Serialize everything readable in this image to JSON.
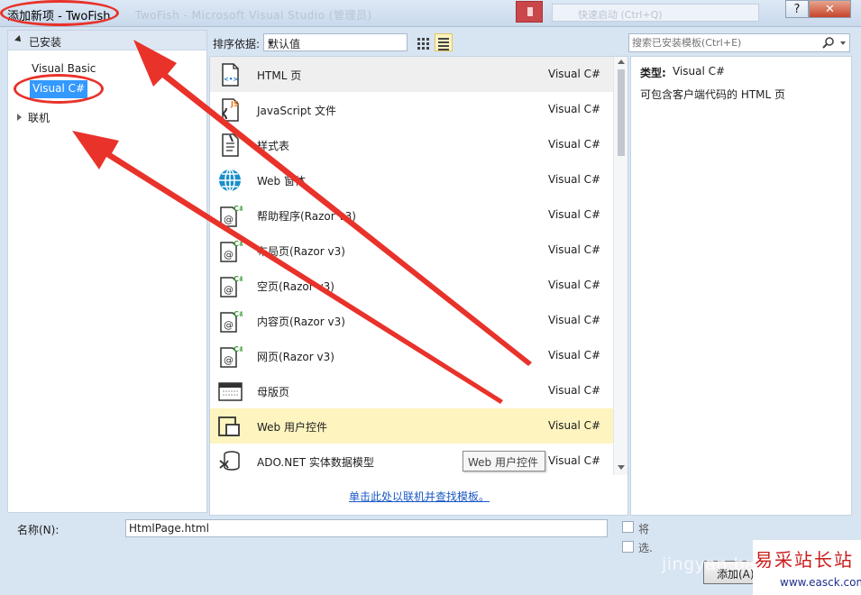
{
  "window": {
    "title": "添加新项 - TwoFish",
    "ghost_title": "TwoFish - Microsoft Visual Studio (管理员)",
    "ghost_search": "快速启动 (Ctrl+Q)",
    "help_label": "?",
    "close_label": "✕"
  },
  "left_panel": {
    "installed_label": "已安装",
    "tree": [
      "Visual Basic",
      "Visual C#"
    ],
    "online_label": "联机"
  },
  "toolbar": {
    "sort_label": "排序依据:",
    "sort_value": "默认值"
  },
  "search": {
    "placeholder": "搜索已安装模板(Ctrl+E)"
  },
  "templates": [
    {
      "name": "HTML 页",
      "lang": "Visual C#",
      "icon": "html-page-icon"
    },
    {
      "name": "JavaScript 文件",
      "lang": "Visual C#",
      "icon": "javascript-file-icon"
    },
    {
      "name": "样式表",
      "lang": "Visual C#",
      "icon": "stylesheet-icon"
    },
    {
      "name": "Web 窗体",
      "lang": "Visual C#",
      "icon": "web-form-globe-icon"
    },
    {
      "name": "帮助程序(Razor v3)",
      "lang": "Visual C#",
      "icon": "razor-file-icon"
    },
    {
      "name": "布局页(Razor v3)",
      "lang": "Visual C#",
      "icon": "razor-file-icon"
    },
    {
      "name": "空页(Razor v3)",
      "lang": "Visual C#",
      "icon": "razor-file-icon"
    },
    {
      "name": "内容页(Razor v3)",
      "lang": "Visual C#",
      "icon": "razor-file-icon"
    },
    {
      "name": "网页(Razor v3)",
      "lang": "Visual C#",
      "icon": "razor-file-icon"
    },
    {
      "name": "母版页",
      "lang": "Visual C#",
      "icon": "master-page-icon"
    },
    {
      "name": "Web 用户控件",
      "lang": "Visual C#",
      "icon": "user-control-icon"
    },
    {
      "name": "ADO.NET 实体数据模型",
      "lang": "Visual C#",
      "icon": "entity-model-icon"
    }
  ],
  "online_link": "单击此处以联机并查找模板。",
  "tooltip": "Web 用户控件",
  "details": {
    "type_label": "类型:",
    "type_value": "Visual C#",
    "description": "可包含客户端代码的 HTML 页"
  },
  "bottom": {
    "name_label": "名称(N):",
    "name_value": "HtmlPage.html",
    "check1": "将",
    "check2": "选.",
    "add_button": "添加(A)"
  },
  "watermark": {
    "en": "jingyan.baidu",
    "cn": "易采站长站",
    "url": "www.easck.com"
  },
  "colors": {
    "annotation": "#e8322a",
    "selection": "#3399ff",
    "hover_row": "#fdf4bf"
  }
}
